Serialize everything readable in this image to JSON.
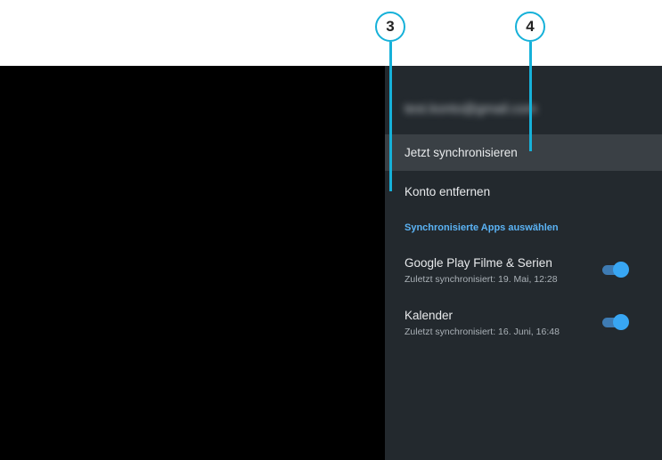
{
  "callouts": {
    "c3": "3",
    "c4": "4"
  },
  "account": {
    "email_blurred": "test.konto@gmail.com"
  },
  "menu": {
    "sync_now": "Jetzt synchronisieren",
    "remove_account": "Konto entfernen"
  },
  "section": {
    "header": "Synchronisierte Apps auswählen"
  },
  "apps": [
    {
      "title": "Google Play Filme & Serien",
      "subtitle": "Zuletzt synchronisiert: 19. Mai, 12:28",
      "enabled": true
    },
    {
      "title": "Kalender",
      "subtitle": "Zuletzt synchronisiert: 16. Juni, 16:48",
      "enabled": true
    }
  ],
  "colors": {
    "panel": "#23292e",
    "focus": "#3a4045",
    "accent": "#5bb3f5",
    "callout": "#16b1d9"
  }
}
